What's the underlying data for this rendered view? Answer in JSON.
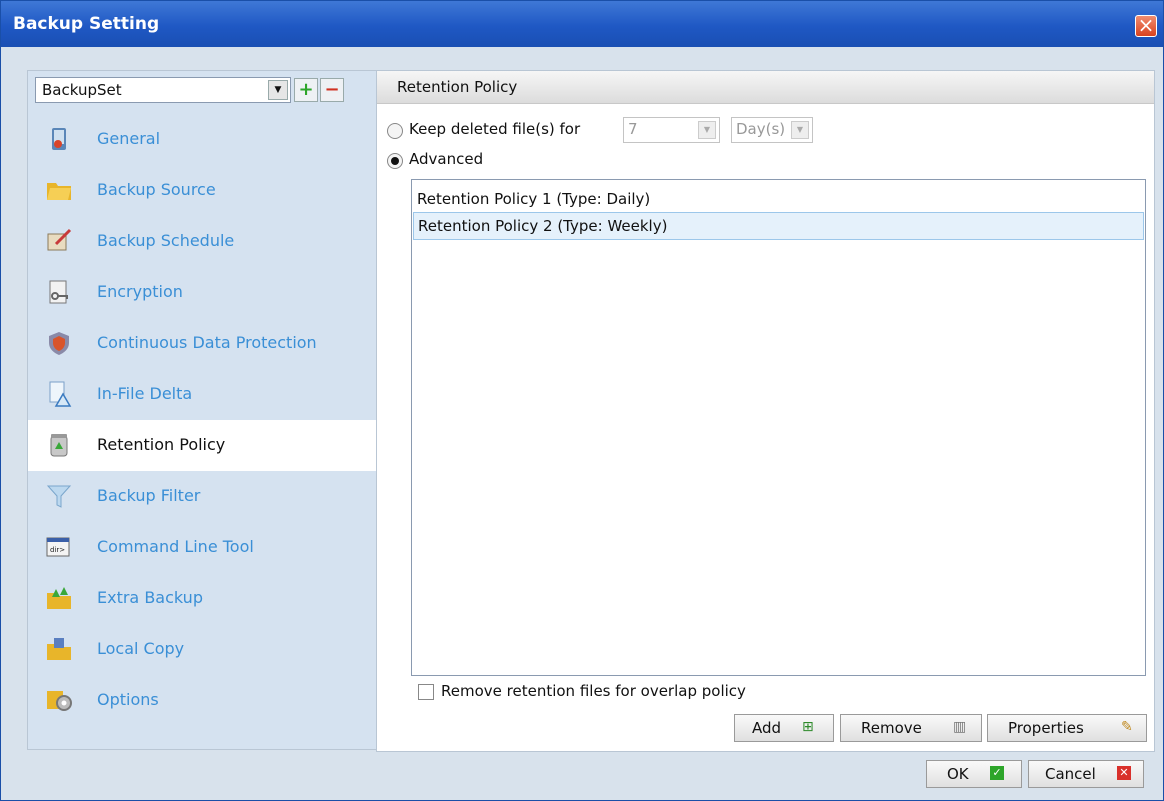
{
  "window": {
    "title": "Backup Setting"
  },
  "sidebar": {
    "backup_set": "BackupSet",
    "items": [
      {
        "label": "General",
        "icon": "general-icon"
      },
      {
        "label": "Backup Source",
        "icon": "folder-icon"
      },
      {
        "label": "Backup Schedule",
        "icon": "schedule-icon"
      },
      {
        "label": "Encryption",
        "icon": "key-icon"
      },
      {
        "label": "Continuous Data Protection",
        "icon": "shield-icon"
      },
      {
        "label": "In-File Delta",
        "icon": "delta-icon"
      },
      {
        "label": "Retention Policy",
        "icon": "recycle-icon",
        "selected": true
      },
      {
        "label": "Backup Filter",
        "icon": "funnel-icon"
      },
      {
        "label": "Command Line Tool",
        "icon": "terminal-icon"
      },
      {
        "label": "Extra Backup",
        "icon": "extra-backup-icon"
      },
      {
        "label": "Local Copy",
        "icon": "local-copy-icon"
      },
      {
        "label": "Options",
        "icon": "options-icon"
      }
    ]
  },
  "main": {
    "header": "Retention Policy",
    "keep_label": "Keep deleted file(s) for",
    "keep_value": "7",
    "keep_unit": "Day(s)",
    "advanced_label": "Advanced",
    "policies": [
      "Retention Policy 1 (Type: Daily)",
      "Retention Policy 2 (Type: Weekly)"
    ],
    "overlap_label": "Remove retention files for overlap policy",
    "buttons": {
      "add": "Add",
      "remove": "Remove",
      "properties": "Properties"
    }
  },
  "footer": {
    "ok": "OK",
    "cancel": "Cancel"
  },
  "colors": {
    "title_bar": "#1f58c4",
    "nav_text": "#3a8fd6",
    "selection": "#e5f1fb"
  }
}
